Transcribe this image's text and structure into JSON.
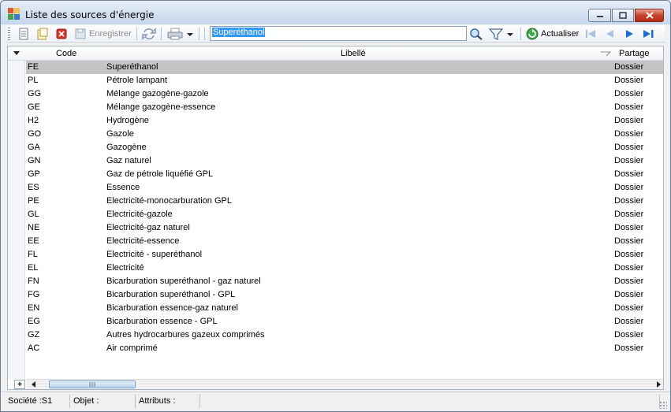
{
  "window": {
    "title": "Liste des sources d'énergie"
  },
  "toolbar": {
    "save_label": "Enregistrer",
    "search_value": "Superéthanol",
    "refresh_label": "Actualiser"
  },
  "grid": {
    "columns": {
      "code": "Code",
      "libelle": "Libellé",
      "partage": "Partage"
    },
    "rows": [
      {
        "code": "FE",
        "libelle": "Superéthanol",
        "partage": "Dossier"
      },
      {
        "code": "PL",
        "libelle": "Pétrole lampant",
        "partage": "Dossier"
      },
      {
        "code": "GG",
        "libelle": "Mélange gazogène-gazole",
        "partage": "Dossier"
      },
      {
        "code": "GE",
        "libelle": "Mélange gazogène-essence",
        "partage": "Dossier"
      },
      {
        "code": "H2",
        "libelle": "Hydrogène",
        "partage": "Dossier"
      },
      {
        "code": "GO",
        "libelle": "Gazole",
        "partage": "Dossier"
      },
      {
        "code": "GA",
        "libelle": "Gazogène",
        "partage": "Dossier"
      },
      {
        "code": "GN",
        "libelle": "Gaz naturel",
        "partage": "Dossier"
      },
      {
        "code": "GP",
        "libelle": "Gaz de pétrole liquéfié GPL",
        "partage": "Dossier"
      },
      {
        "code": "ES",
        "libelle": "Essence",
        "partage": "Dossier"
      },
      {
        "code": "PE",
        "libelle": "Electricité-monocarburation GPL",
        "partage": "Dossier"
      },
      {
        "code": "GL",
        "libelle": "Electricité-gazole",
        "partage": "Dossier"
      },
      {
        "code": "NE",
        "libelle": "Electricité-gaz naturel",
        "partage": "Dossier"
      },
      {
        "code": "EE",
        "libelle": "Electricité-essence",
        "partage": "Dossier"
      },
      {
        "code": "FL",
        "libelle": "Electricité - superéthanol",
        "partage": "Dossier"
      },
      {
        "code": "EL",
        "libelle": "Electricité",
        "partage": "Dossier"
      },
      {
        "code": "FN",
        "libelle": "Bicarburation superéthanol - gaz naturel",
        "partage": "Dossier"
      },
      {
        "code": "FG",
        "libelle": "Bicarburation superéthanol - GPL",
        "partage": "Dossier"
      },
      {
        "code": "EN",
        "libelle": "Bicarburation essence-gaz naturel",
        "partage": "Dossier"
      },
      {
        "code": "EG",
        "libelle": "Bicarburation essence - GPL",
        "partage": "Dossier"
      },
      {
        "code": "GZ",
        "libelle": "Autres hydrocarbures gazeux comprimés",
        "partage": "Dossier"
      },
      {
        "code": "AC",
        "libelle": "Air comprimé",
        "partage": "Dossier"
      }
    ]
  },
  "statusbar": {
    "societe": "Société :S1",
    "objet": "Objet :",
    "attributs": "Attributs :"
  },
  "colors": {
    "selected_row": "#c4c4c4",
    "accent_blue": "#1a6fd6",
    "close_red": "#c9422a"
  }
}
